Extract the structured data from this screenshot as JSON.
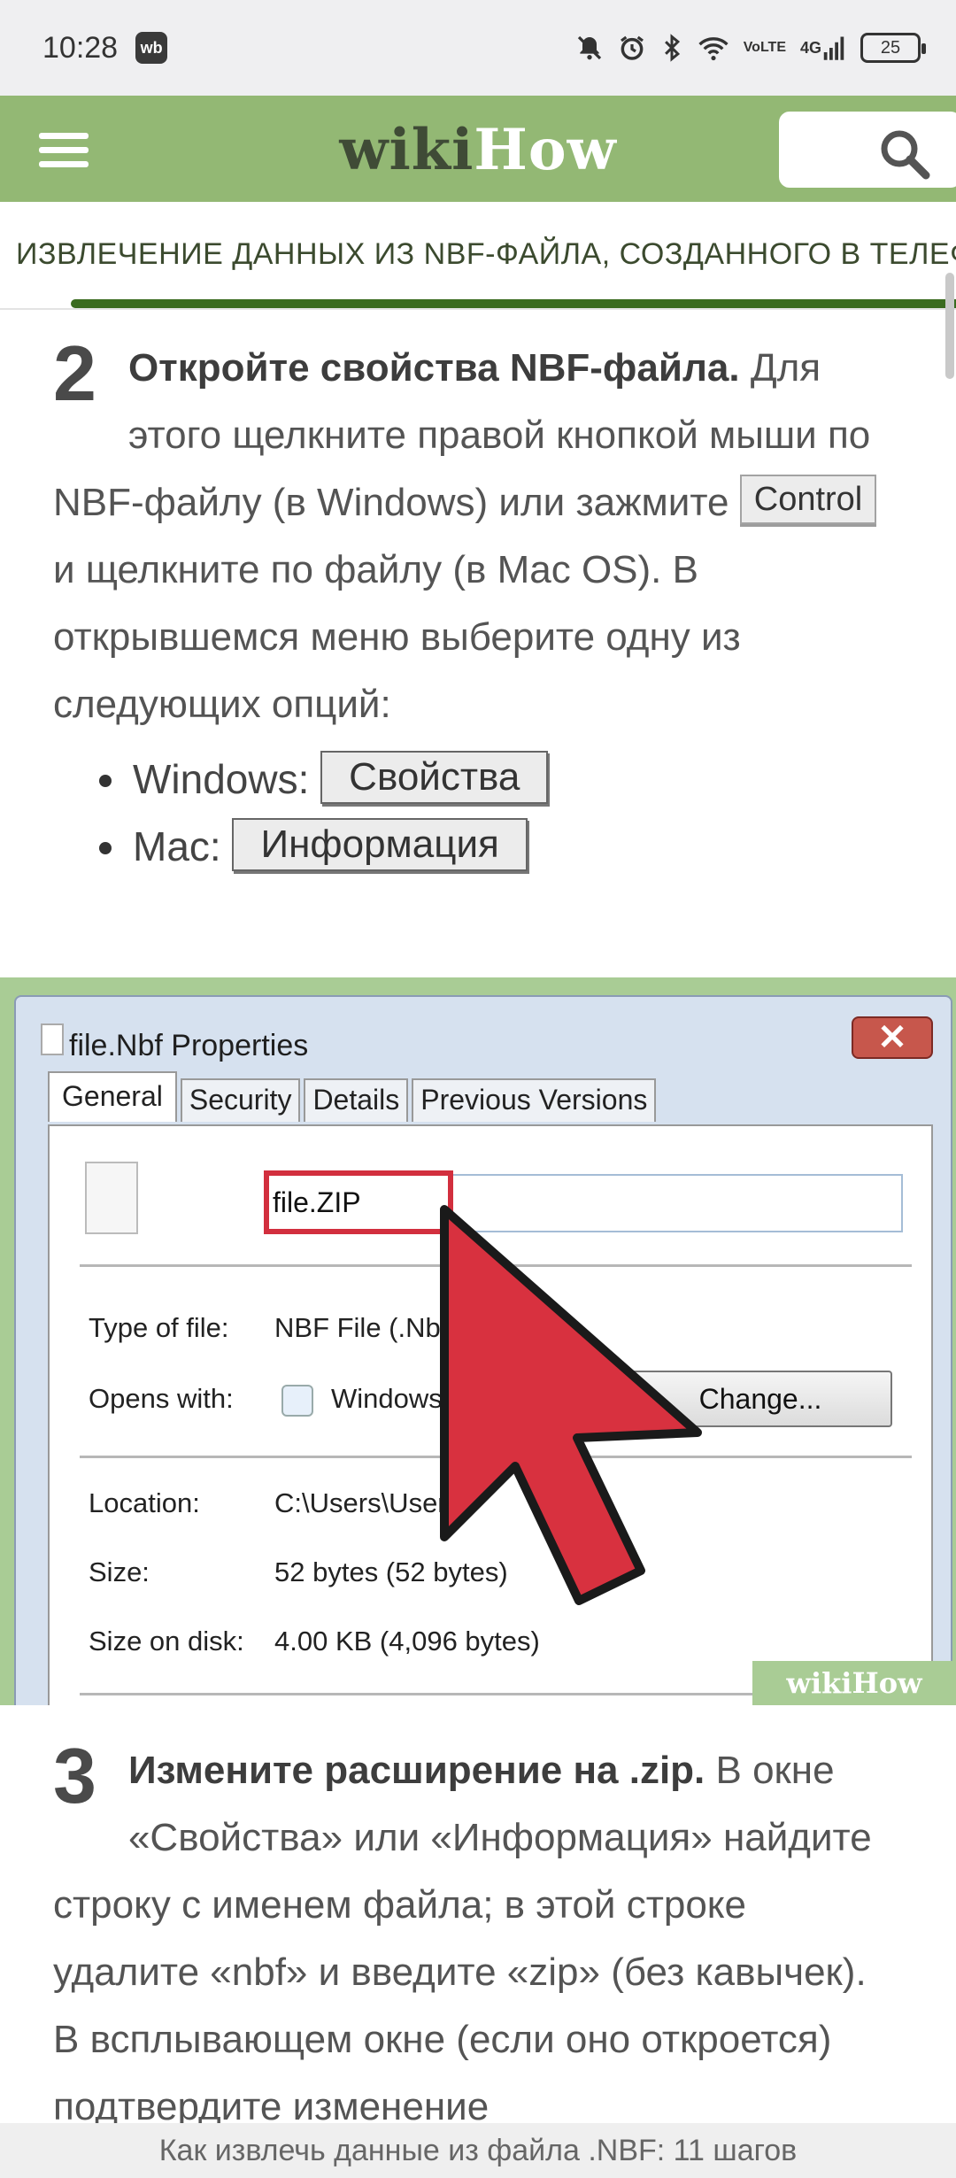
{
  "status_bar": {
    "time": "10:28",
    "app_badge": "wb",
    "volte_top": "Vo",
    "volte_bottom": "LTE",
    "network": "4G",
    "battery": "25"
  },
  "header": {
    "logo_wiki": "wiki",
    "logo_how": "How"
  },
  "article": {
    "title": "ИЗВЛЕЧЕНИЕ ДАННЫХ ИЗ NBF-ФАЙЛА, СОЗДАННОГО В ТЕЛЕФОНЕ NOKIA",
    "step2": {
      "number": "2",
      "bold": "Откройте свойства NBF-файла.",
      "text_a": " Для этого щелкните правой кнопкой мыши по NBF-файлу (в Windows) или зажмите ",
      "key": "Control",
      "text_b": " и щелкните по файлу (в Mac OS). В открывшемся меню выберите одну из следующих опций:",
      "bullets": [
        {
          "label": "Windows:",
          "button": "Свойства"
        },
        {
          "label": "Mac:",
          "button": "Информация"
        }
      ]
    },
    "illustration": {
      "window_title": "file.Nbf Properties",
      "close_symbol": "✕",
      "tabs": [
        "General",
        "Security",
        "Details",
        "Previous Versions"
      ],
      "file_name": "file.ZIP",
      "rows": [
        {
          "label": "Type of file:",
          "value": "NBF File (.Nbf)"
        },
        {
          "label": "Opens with:",
          "value": "Windows"
        },
        {
          "label": "Location:",
          "value": "C:\\Users\\User\\"
        },
        {
          "label": "Size:",
          "value": "52 bytes (52 bytes)"
        },
        {
          "label": "Size on disk:",
          "value": "4.00 KB (4,096 bytes)"
        }
      ],
      "change_button": "Change...",
      "watermark": "wikiHow"
    },
    "step3": {
      "number": "3",
      "bold": "Измените расширение на .zip.",
      "text": " В окне «Свойства» или «Информация» найдите строку с именем файла; в этой строке удалите «nbf» и введите «zip» (без кавычек). В всплывающем окне (если оно откроется) подтвердите изменение"
    }
  },
  "bottom_caption": "Как извлечь данные из файла .NBF: 11 шагов",
  "colors": {
    "header_green": "#93b874",
    "progress_green": "#3a6b1f",
    "highlight_red": "#d22f3e"
  }
}
